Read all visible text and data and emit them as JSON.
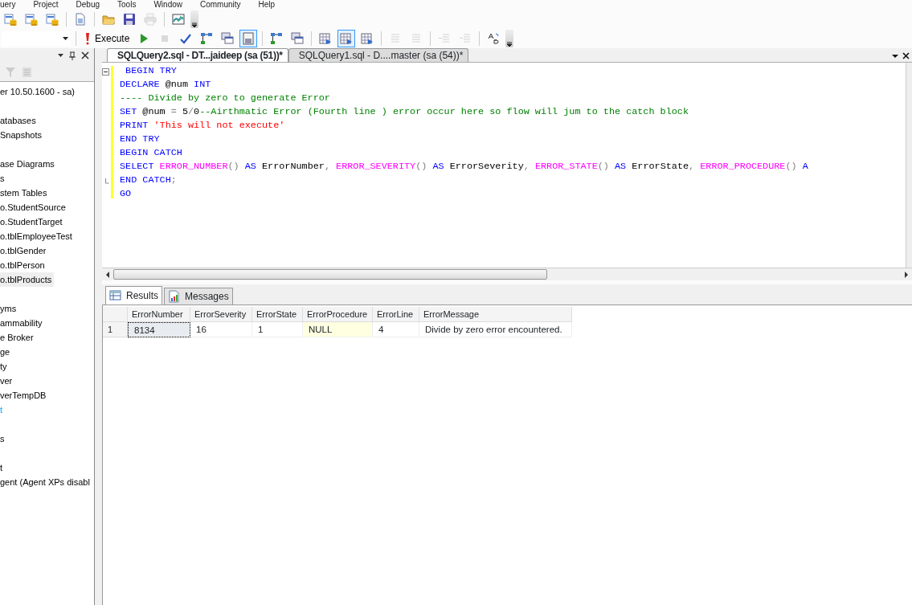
{
  "menu": [
    "uery",
    "Project",
    "Debug",
    "Tools",
    "Window",
    "Community",
    "Help"
  ],
  "standard_toolbar": [
    {
      "kind": "db"
    },
    {
      "kind": "db"
    },
    {
      "kind": "db"
    },
    {
      "kind": "sep"
    },
    {
      "kind": "doc"
    },
    {
      "kind": "sep"
    },
    {
      "kind": "folder"
    },
    {
      "kind": "save"
    },
    {
      "kind": "print",
      "disabled": true
    },
    {
      "kind": "sep"
    },
    {
      "kind": "chart"
    }
  ],
  "query_toolbar": [
    {
      "kind": "execute",
      "label": "Execute"
    },
    {
      "kind": "run"
    },
    {
      "kind": "stop",
      "disabled": true
    },
    {
      "kind": "check"
    },
    {
      "kind": "tree",
      "selected": false
    },
    {
      "kind": "windows",
      "selected": false
    },
    {
      "kind": "form",
      "selected": true
    },
    {
      "kind": "sep"
    },
    {
      "kind": "tree",
      "selected": false
    },
    {
      "kind": "windows",
      "selected": false
    },
    {
      "kind": "sep"
    },
    {
      "kind": "table",
      "selected": false
    },
    {
      "kind": "table",
      "selected": true
    },
    {
      "kind": "table",
      "selected": false
    },
    {
      "kind": "sep"
    },
    {
      "kind": "lines",
      "disabled": true
    },
    {
      "kind": "lines",
      "disabled": true
    },
    {
      "kind": "sep"
    },
    {
      "kind": "indent",
      "disabled": true
    },
    {
      "kind": "indent",
      "disabled": true
    },
    {
      "kind": "sep"
    },
    {
      "kind": "letters"
    }
  ],
  "object_explorer": {
    "items": [
      {
        "kind": "row",
        "text": "er 10.50.1600 - sa)",
        "selected": false
      },
      {
        "kind": "blank"
      },
      {
        "kind": "row",
        "text": "atabases",
        "selected": false
      },
      {
        "kind": "row",
        "text": "Snapshots",
        "selected": false
      },
      {
        "kind": "blank"
      },
      {
        "kind": "row",
        "text": "ase Diagrams",
        "selected": false
      },
      {
        "kind": "row",
        "text": "s",
        "selected": false
      },
      {
        "kind": "row",
        "text": "stem Tables",
        "selected": false
      },
      {
        "kind": "row",
        "text": "o.StudentSource",
        "selected": false
      },
      {
        "kind": "row",
        "text": "o.StudentTarget",
        "selected": false
      },
      {
        "kind": "row",
        "text": "o.tblEmployeeTest",
        "selected": false
      },
      {
        "kind": "row",
        "text": "o.tblGender",
        "selected": false
      },
      {
        "kind": "row",
        "text": "o.tblPerson",
        "selected": false
      },
      {
        "kind": "row",
        "text": "o.tblProducts",
        "selected": true
      },
      {
        "kind": "blank"
      },
      {
        "kind": "row",
        "text": "yms",
        "selected": false
      },
      {
        "kind": "row",
        "text": "ammability",
        "selected": false
      },
      {
        "kind": "row",
        "text": "e Broker",
        "selected": false
      },
      {
        "kind": "row",
        "text": "ge",
        "selected": false
      },
      {
        "kind": "row",
        "text": "ty",
        "selected": false
      },
      {
        "kind": "row",
        "text": "ver",
        "selected": false
      },
      {
        "kind": "row",
        "text": "verTempDB",
        "selected": false
      },
      {
        "kind": "link",
        "text": "t",
        "selected": false
      },
      {
        "kind": "blank"
      },
      {
        "kind": "row",
        "text": "s",
        "selected": false
      },
      {
        "kind": "blank"
      },
      {
        "kind": "row",
        "text": "t",
        "selected": false
      },
      {
        "kind": "row",
        "text": "gent (Agent XPs disabl",
        "selected": false
      }
    ]
  },
  "document_tabs": [
    {
      "label": "SQLQuery2.sql - DT...jaideep (sa (51))*",
      "selected": true
    },
    {
      "label": "SQLQuery1.sql - D....master (sa (54))*",
      "selected": false
    }
  ],
  "editor": {
    "lines": [
      {
        "fold_start": true,
        "tokens": [
          {
            "kind": "kw",
            "text": " BEGIN TRY"
          }
        ]
      },
      {
        "tokens": [
          {
            "kind": "kw",
            "text": "DECLARE"
          },
          {
            "kind": "plain",
            "text": " @num "
          },
          {
            "kind": "kw",
            "text": "INT"
          }
        ]
      },
      {
        "tokens": [
          {
            "kind": "comment",
            "text": "---- Divide by zero to generate Error"
          }
        ]
      },
      {
        "tokens": [
          {
            "kind": "kw",
            "text": "SET"
          },
          {
            "kind": "plain",
            "text": " @num "
          },
          {
            "kind": "op",
            "text": "="
          },
          {
            "kind": "plain",
            "text": " 5"
          },
          {
            "kind": "op",
            "text": "/"
          },
          {
            "kind": "plain",
            "text": "0"
          },
          {
            "kind": "comment",
            "text": "--Airthmatic Error (Fourth line ) error occur here so flow will jum to the catch block"
          }
        ]
      },
      {
        "tokens": [
          {
            "kind": "kw",
            "text": "PRINT "
          },
          {
            "kind": "string",
            "text": "'This will not execute'"
          }
        ]
      },
      {
        "tokens": [
          {
            "kind": "kw",
            "text": "END TRY"
          }
        ]
      },
      {
        "tokens": [
          {
            "kind": "kw",
            "text": "BEGIN CATCH"
          }
        ]
      },
      {
        "tokens": [
          {
            "kind": "kw",
            "text": "SELECT "
          },
          {
            "kind": "fn",
            "text": "ERROR_NUMBER"
          },
          {
            "kind": "op",
            "text": "() "
          },
          {
            "kind": "kw",
            "text": "AS"
          },
          {
            "kind": "plain",
            "text": " ErrorNumber"
          },
          {
            "kind": "op",
            "text": ", "
          },
          {
            "kind": "fn",
            "text": "ERROR_SEVERITY"
          },
          {
            "kind": "op",
            "text": "() "
          },
          {
            "kind": "kw",
            "text": "AS"
          },
          {
            "kind": "plain",
            "text": " ErrorSeverity"
          },
          {
            "kind": "op",
            "text": ", "
          },
          {
            "kind": "fn",
            "text": "ERROR_STATE"
          },
          {
            "kind": "op",
            "text": "() "
          },
          {
            "kind": "kw",
            "text": "AS"
          },
          {
            "kind": "plain",
            "text": " ErrorState"
          },
          {
            "kind": "op",
            "text": ", "
          },
          {
            "kind": "fn",
            "text": "ERROR_PROCEDURE"
          },
          {
            "kind": "op",
            "text": "() "
          },
          {
            "kind": "kw",
            "text": "A"
          }
        ]
      },
      {
        "fold_end": true,
        "tokens": [
          {
            "kind": "kw",
            "text": "END CATCH"
          },
          {
            "kind": "op",
            "text": ";"
          }
        ]
      },
      {
        "tokens": [
          {
            "kind": "kw",
            "text": "GO"
          }
        ]
      }
    ]
  },
  "results_tabs": [
    {
      "label": "Results",
      "kind": "grid",
      "selected": true
    },
    {
      "label": "Messages",
      "kind": "messages",
      "selected": false
    }
  ],
  "results": {
    "columns": [
      "ErrorNumber",
      "ErrorSeverity",
      "ErrorState",
      "ErrorProcedure",
      "ErrorLine",
      "ErrorMessage"
    ],
    "rows": [
      {
        "number": "1",
        "cells": [
          {
            "text": "8134",
            "selected": true,
            "is_null": false
          },
          {
            "text": "16",
            "selected": false,
            "is_null": false
          },
          {
            "text": "1",
            "selected": false,
            "is_null": false
          },
          {
            "text": "NULL",
            "selected": false,
            "is_null": true
          },
          {
            "text": "4",
            "selected": false,
            "is_null": false
          },
          {
            "text": "Divide by zero error encountered.",
            "selected": false,
            "is_null": false
          }
        ]
      }
    ]
  }
}
